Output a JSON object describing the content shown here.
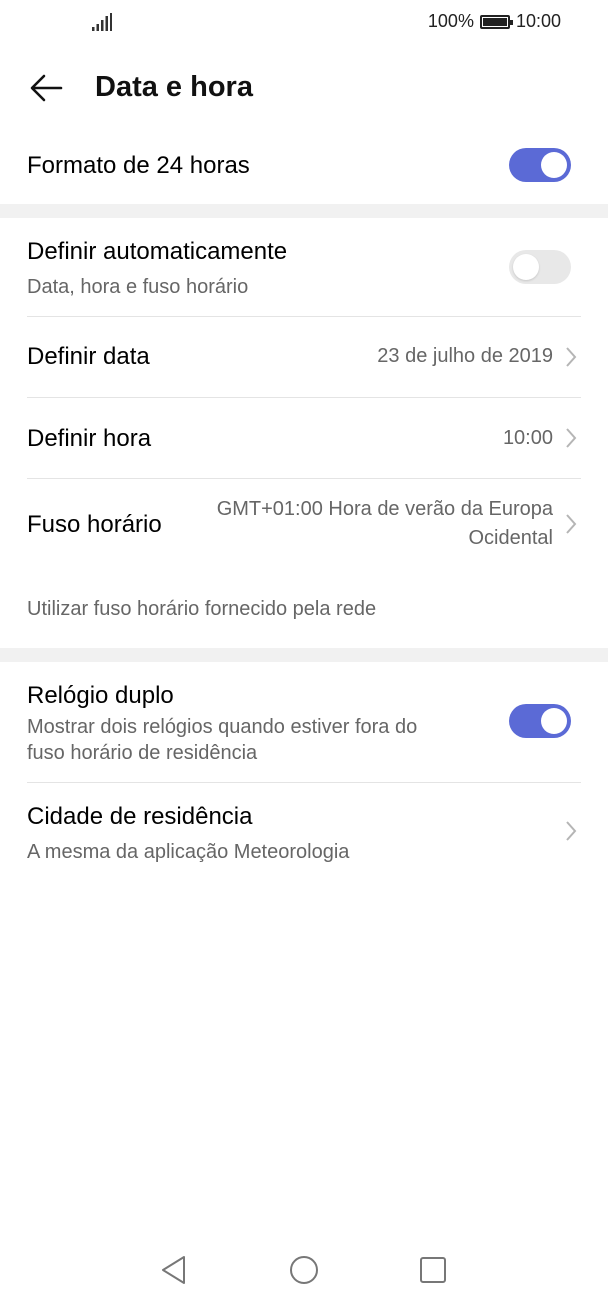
{
  "status_bar": {
    "battery_percent": "100%",
    "time": "10:00"
  },
  "header": {
    "title": "Data e hora"
  },
  "settings": {
    "format_24h": {
      "label": "Formato de 24 horas",
      "enabled": true
    },
    "auto_set": {
      "label": "Definir automaticamente",
      "subtitle": "Data, hora e fuso horário",
      "enabled": false
    },
    "set_date": {
      "label": "Definir data",
      "value": "23 de julho de 2019"
    },
    "set_time": {
      "label": "Definir hora",
      "value": "10:00"
    },
    "time_zone": {
      "label": "Fuso horário",
      "value_line1": "GMT+01:00 Hora de verão da Europa",
      "value_line2": "Ocidental"
    },
    "network_tz_note": "Utilizar fuso horário fornecido pela rede",
    "dual_clock": {
      "label": "Relógio duplo",
      "subtitle_line1": "Mostrar dois relógios quando estiver fora do",
      "subtitle_line2": "fuso horário de residência",
      "enabled": true
    },
    "home_city": {
      "label": "Cidade de residência",
      "subtitle": "A mesma da aplicação Meteorologia"
    }
  },
  "colors": {
    "accent": "#5b6ad6",
    "toggle_off": "#e8e8e8",
    "section_gap": "#f1f1f1"
  },
  "icons": [
    "signal-icon",
    "battery-icon",
    "back-arrow-icon",
    "chevron-right-icon",
    "nav-back-icon",
    "nav-home-icon",
    "nav-recents-icon"
  ]
}
